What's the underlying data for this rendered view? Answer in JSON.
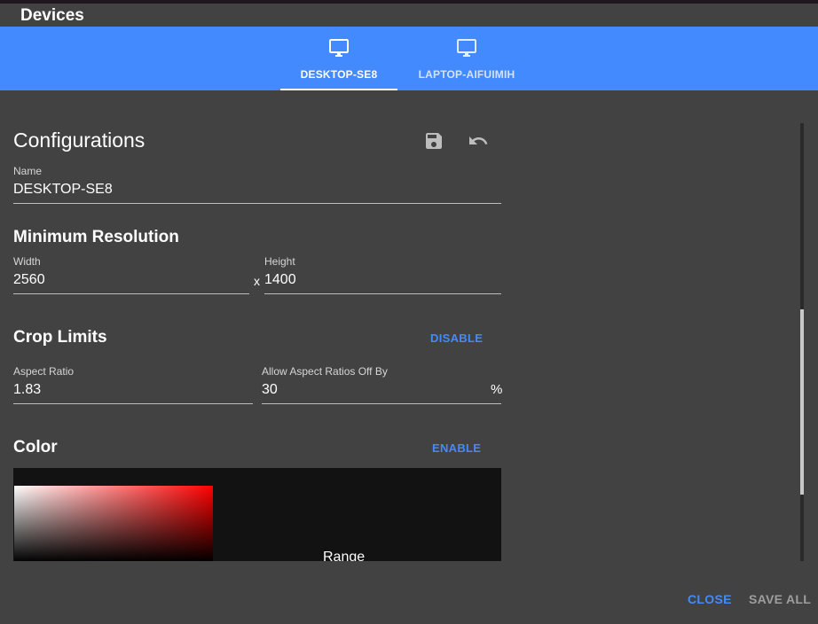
{
  "dialog": {
    "title": "Devices"
  },
  "tabs": [
    {
      "label": "DESKTOP-SE8",
      "icon": "monitor-icon",
      "active": true
    },
    {
      "label": "LAPTOP-AIFUIMIH",
      "icon": "monitor-icon",
      "active": false
    }
  ],
  "config": {
    "title": "Configurations",
    "name_label": "Name",
    "name_value": "DESKTOP-SE8",
    "actions": {
      "save_icon": "save-icon",
      "undo_icon": "undo-icon"
    }
  },
  "min_resolution": {
    "title": "Minimum Resolution",
    "width_label": "Width",
    "width_value": "2560",
    "separator": "x",
    "height_label": "Height",
    "height_value": "1400"
  },
  "crop": {
    "title": "Crop Limits",
    "toggle_label": "DISABLE",
    "aspect_label": "Aspect Ratio",
    "aspect_value": "1.83",
    "off_label": "Allow Aspect Ratios Off By",
    "off_value": "30",
    "off_suffix": "%"
  },
  "color": {
    "title": "Color",
    "toggle_label": "ENABLE",
    "range_label": "Range"
  },
  "footer": {
    "close_label": "CLOSE",
    "save_all_label": "SAVE ALL"
  },
  "colors": {
    "accent": "#448aff",
    "background": "#424242",
    "panel": "#121212",
    "disabled_text": "#9e9e9e"
  }
}
